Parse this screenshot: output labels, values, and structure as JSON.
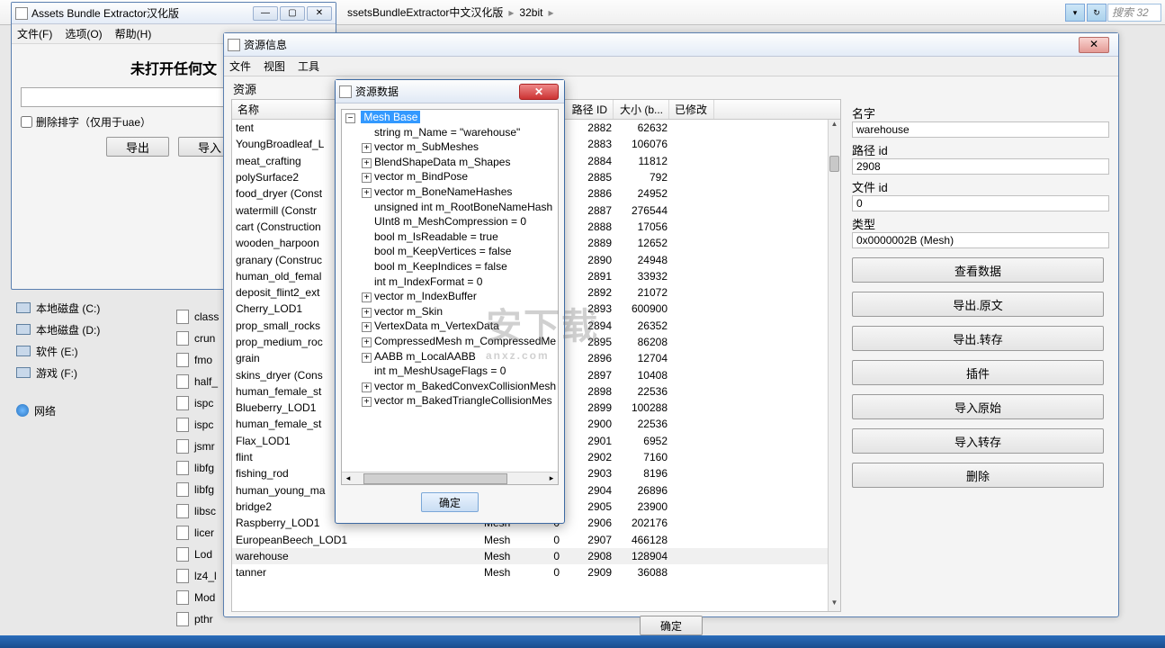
{
  "breadcrumb": {
    "part1": "ssetsBundleExtractor中文汉化版",
    "part2": "32bit",
    "search_placeholder": "搜索 32"
  },
  "mainwin": {
    "title": "Assets Bundle Extractor汉化版",
    "menu": {
      "file": "文件(F)",
      "options": "选项(O)",
      "help": "帮助(H)"
    },
    "no_file_msg": "未打开任何文",
    "chk_label": "删除排字（仅用于uae）",
    "btn_export": "导出",
    "btn_import": "导入"
  },
  "explorer": {
    "drives": [
      {
        "label": "本地磁盘 (C:)"
      },
      {
        "label": "本地磁盘 (D:)"
      },
      {
        "label": "软件 (E:)"
      },
      {
        "label": "游戏 (F:)"
      }
    ],
    "network": "网络",
    "files": [
      "class",
      "crun",
      "fmo",
      "half_",
      "ispc",
      "ispc",
      "jsmr",
      "libfg",
      "libfg",
      "libsc",
      "licer",
      "Lod",
      "lz4_l",
      "Mod",
      "pthr"
    ]
  },
  "reswin": {
    "title": "资源信息",
    "menu": {
      "file": "文件",
      "view": "视图",
      "tools": "工具"
    },
    "heading": "资源",
    "columns": {
      "name": "名称",
      "type": "",
      "fid": "",
      "pid": "路径 ID",
      "size": "大小 (b...",
      "mod": "已修改"
    },
    "rows": [
      {
        "name": "tent",
        "type": "",
        "fid": "",
        "pid": "2882",
        "size": "62632"
      },
      {
        "name": "YoungBroadleaf_L",
        "type": "",
        "fid": "",
        "pid": "2883",
        "size": "106076"
      },
      {
        "name": "meat_crafting",
        "type": "",
        "fid": "",
        "pid": "2884",
        "size": "11812"
      },
      {
        "name": "polySurface2",
        "type": "",
        "fid": "",
        "pid": "2885",
        "size": "792"
      },
      {
        "name": "food_dryer (Const",
        "type": "",
        "fid": "",
        "pid": "2886",
        "size": "24952"
      },
      {
        "name": "watermill (Constr",
        "type": "",
        "fid": "",
        "pid": "2887",
        "size": "276544"
      },
      {
        "name": "cart (Construction",
        "type": "",
        "fid": "",
        "pid": "2888",
        "size": "17056"
      },
      {
        "name": "wooden_harpoon",
        "type": "",
        "fid": "",
        "pid": "2889",
        "size": "12652"
      },
      {
        "name": "granary (Construc",
        "type": "",
        "fid": "",
        "pid": "2890",
        "size": "24948"
      },
      {
        "name": "human_old_femal",
        "type": "",
        "fid": "",
        "pid": "2891",
        "size": "33932"
      },
      {
        "name": "deposit_flint2_ext",
        "type": "",
        "fid": "",
        "pid": "2892",
        "size": "21072"
      },
      {
        "name": "Cherry_LOD1",
        "type": "",
        "fid": "",
        "pid": "2893",
        "size": "600900"
      },
      {
        "name": "prop_small_rocks",
        "type": "",
        "fid": "",
        "pid": "2894",
        "size": "26352"
      },
      {
        "name": "prop_medium_roc",
        "type": "",
        "fid": "",
        "pid": "2895",
        "size": "86208"
      },
      {
        "name": "grain",
        "type": "",
        "fid": "",
        "pid": "2896",
        "size": "12704"
      },
      {
        "name": "skins_dryer (Cons",
        "type": "",
        "fid": "",
        "pid": "2897",
        "size": "10408"
      },
      {
        "name": "human_female_st",
        "type": "",
        "fid": "",
        "pid": "2898",
        "size": "22536"
      },
      {
        "name": "Blueberry_LOD1",
        "type": "",
        "fid": "",
        "pid": "2899",
        "size": "100288"
      },
      {
        "name": "human_female_st",
        "type": "",
        "fid": "",
        "pid": "2900",
        "size": "22536"
      },
      {
        "name": "Flax_LOD1",
        "type": "",
        "fid": "",
        "pid": "2901",
        "size": "6952"
      },
      {
        "name": "flint",
        "type": "",
        "fid": "",
        "pid": "2902",
        "size": "7160"
      },
      {
        "name": "fishing_rod",
        "type": "",
        "fid": "",
        "pid": "2903",
        "size": "8196"
      },
      {
        "name": "human_young_ma",
        "type": "",
        "fid": "",
        "pid": "2904",
        "size": "26896"
      },
      {
        "name": "bridge2",
        "type": "",
        "fid": "",
        "pid": "2905",
        "size": "23900"
      },
      {
        "name": "Raspberry_LOD1",
        "type": "Mesh",
        "fid": "0",
        "pid": "2906",
        "size": "202176"
      },
      {
        "name": "EuropeanBeech_LOD1",
        "type": "Mesh",
        "fid": "0",
        "pid": "2907",
        "size": "466128"
      },
      {
        "name": "warehouse",
        "type": "Mesh",
        "fid": "0",
        "pid": "2908",
        "size": "128904",
        "sel": true
      },
      {
        "name": "tanner",
        "type": "Mesh",
        "fid": "0",
        "pid": "2909",
        "size": "36088"
      }
    ],
    "details": {
      "labels": {
        "name": "名字",
        "pathid": "路径 id",
        "fileid": "文件 id",
        "type": "类型"
      },
      "values": {
        "name": "warehouse",
        "pathid": "2908",
        "fileid": "0",
        "type": "0x0000002B (Mesh)"
      },
      "buttons": {
        "view": "查看数据",
        "export_raw": "导出.原文",
        "export_dump": "导出.转存",
        "plugins": "插件",
        "import_raw": "导入原始",
        "import_dump": "导入转存",
        "delete": "删除"
      }
    },
    "ok": "确定"
  },
  "datadlg": {
    "title": "资源数据",
    "root": "Mesh Base",
    "nodes": [
      {
        "exp": "",
        "ind": 2,
        "t": "string m_Name = \"warehouse\""
      },
      {
        "exp": "+",
        "ind": 1,
        "t": "vector m_SubMeshes"
      },
      {
        "exp": "+",
        "ind": 1,
        "t": "BlendShapeData m_Shapes"
      },
      {
        "exp": "+",
        "ind": 1,
        "t": "vector m_BindPose"
      },
      {
        "exp": "+",
        "ind": 1,
        "t": "vector m_BoneNameHashes"
      },
      {
        "exp": "",
        "ind": 2,
        "t": "unsigned int m_RootBoneNameHash"
      },
      {
        "exp": "",
        "ind": 2,
        "t": "UInt8 m_MeshCompression = 0"
      },
      {
        "exp": "",
        "ind": 2,
        "t": "bool m_IsReadable = true"
      },
      {
        "exp": "",
        "ind": 2,
        "t": "bool m_KeepVertices = false"
      },
      {
        "exp": "",
        "ind": 2,
        "t": "bool m_KeepIndices = false"
      },
      {
        "exp": "",
        "ind": 2,
        "t": "int m_IndexFormat = 0"
      },
      {
        "exp": "+",
        "ind": 1,
        "t": "vector m_IndexBuffer"
      },
      {
        "exp": "+",
        "ind": 1,
        "t": "vector m_Skin"
      },
      {
        "exp": "+",
        "ind": 1,
        "t": "VertexData m_VertexData"
      },
      {
        "exp": "+",
        "ind": 1,
        "t": "CompressedMesh m_CompressedMe"
      },
      {
        "exp": "+",
        "ind": 1,
        "t": "AABB m_LocalAABB"
      },
      {
        "exp": "",
        "ind": 2,
        "t": "int m_MeshUsageFlags = 0"
      },
      {
        "exp": "+",
        "ind": 1,
        "t": "vector m_BakedConvexCollisionMesh"
      },
      {
        "exp": "+",
        "ind": 1,
        "t": "vector m_BakedTriangleCollisionMes"
      }
    ],
    "ok": "确定"
  },
  "watermark": {
    "line1": "安下载",
    "line2": "anxz.com"
  }
}
